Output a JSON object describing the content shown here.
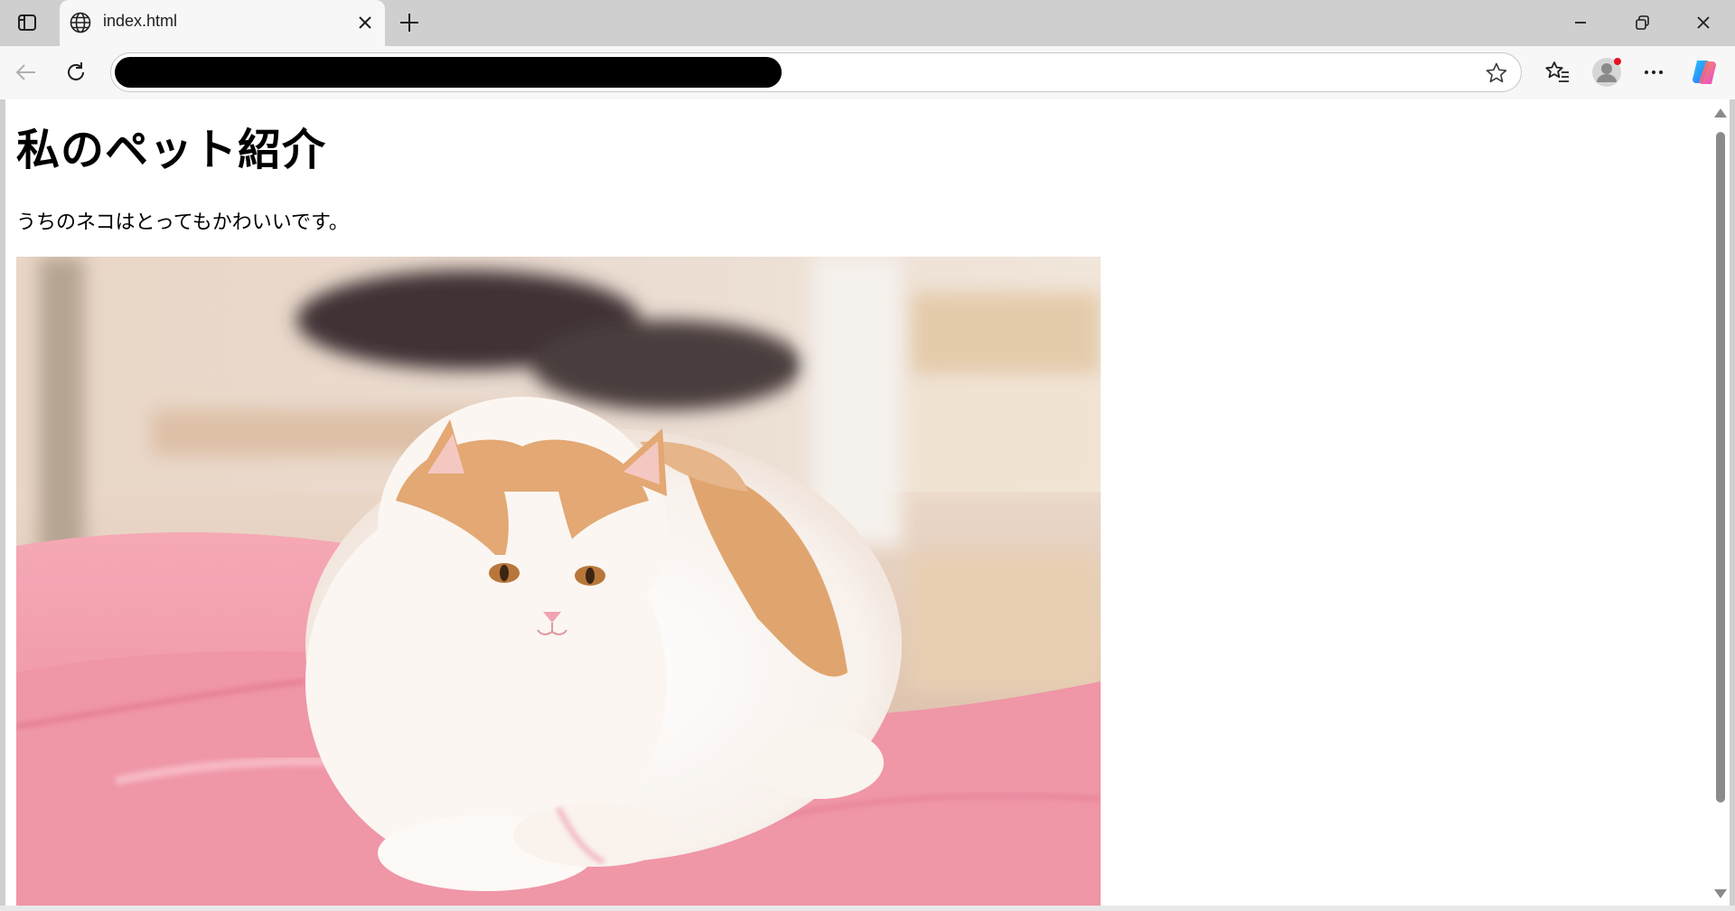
{
  "browser": {
    "tab": {
      "title": "index.html",
      "icon": "globe-icon"
    },
    "address_bar": {
      "url": ""
    },
    "icons": {
      "tab_actions": "tab-actions-icon",
      "new_tab": "plus-icon",
      "minimize": "minimize-icon",
      "restore": "restore-icon",
      "close": "close-icon",
      "back": "back-arrow-icon",
      "reload": "reload-icon",
      "favorite": "star-icon",
      "favorites": "favorites-icon",
      "profile": "profile-icon",
      "more": "more-icon",
      "copilot": "copilot-icon"
    }
  },
  "page": {
    "heading": "私のペット紹介",
    "paragraph": "うちのネコはとってもかわいいです。",
    "image": "cat-photo"
  },
  "colors": {
    "chrome_bg": "#cfcfcf",
    "toolbar_bg": "#f7f7f7",
    "page_bg": "#ffffff",
    "cushion_pink": "#f19aa9"
  }
}
